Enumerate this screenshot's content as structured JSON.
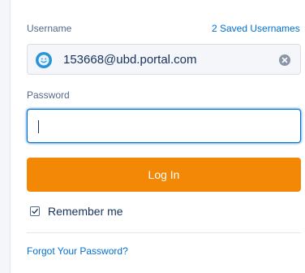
{
  "username": {
    "label": "Username",
    "saved_link": "2 Saved Usernames",
    "value": "153668@ubd.portal.com",
    "avatar_icon": "smiley-face-icon",
    "clear_icon": "clear-x-icon"
  },
  "password": {
    "label": "Password",
    "value": ""
  },
  "login_button": {
    "label": "Log In",
    "color": "#f28805"
  },
  "remember": {
    "label": "Remember me",
    "checked": true
  },
  "forgot_link": "Forgot Your Password?",
  "colors": {
    "link": "#0070d2",
    "label": "#54698d",
    "text": "#16325c",
    "focus_border": "#0070d2"
  }
}
